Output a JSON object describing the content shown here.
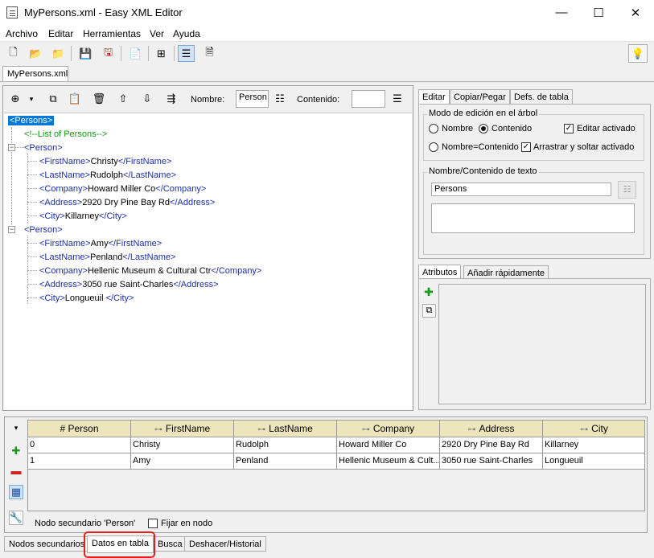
{
  "window": {
    "title": "MyPersons.xml - Easy XML Editor",
    "minimize": "—",
    "maximize": "☐",
    "close": "✕"
  },
  "menu": [
    "Archivo",
    "Editar",
    "Herramientas",
    "Ver",
    "Ayuda"
  ],
  "toolbar_icons": [
    "new-file-icon",
    "open-folder-icon",
    "open-folder-alt-icon",
    "save-icon",
    "save-all-icon",
    "export-icon",
    "tree-structure-icon",
    "text-align-icon",
    "document-icon",
    "lightbulb-icon"
  ],
  "doc_tab": "MyPersons.xml",
  "tree_toolbar": {
    "name_label": "Nombre:",
    "name_value": "Person",
    "content_label": "Contenido:",
    "content_value": ""
  },
  "tree": {
    "root": "<Persons>",
    "comment": "<!--List of Persons-->",
    "person1": {
      "open": "<Person>",
      "firstname": {
        "open": "<FirstName>",
        "value": "Christy",
        "close": "</FirstName>"
      },
      "lastname": {
        "open": "<LastName>",
        "value": "Rudolph",
        "close": "</LastName>"
      },
      "company": {
        "open": "<Company>",
        "value": "Howard Miller Co",
        "close": "</Company>"
      },
      "address": {
        "open": "<Address>",
        "value": "2920 Dry Pine Bay Rd",
        "close": "</Address>"
      },
      "city": {
        "open": "<City>",
        "value": "Killarney",
        "close": "</City>"
      }
    },
    "person2": {
      "open": "<Person>",
      "firstname": {
        "open": "<FirstName>",
        "value": "Amy",
        "close": "</FirstName>"
      },
      "lastname": {
        "open": "<LastName>",
        "value": "Penland",
        "close": "</LastName>"
      },
      "company": {
        "open": "<Company>",
        "value": "Hellenic Museum & Cultural Ctr",
        "close": "</Company>"
      },
      "address": {
        "open": "<Address>",
        "value": "3050 rue Saint-Charles",
        "close": "</Address>"
      },
      "city": {
        "open": "<City>",
        "value": "Longueuil ",
        "close": "</City>"
      }
    }
  },
  "edit_tabs": [
    "Editar",
    "Copiar/Pegar",
    "Defs. de tabla"
  ],
  "edit_panel": {
    "mode_title": "Modo de edición en el árbol",
    "radio_name": "Nombre",
    "radio_content": "Contenido",
    "radio_both": "Nombre=Contenido",
    "edit_enabled": "Editar activado",
    "drag_drop": "Arrastrar y soltar activado",
    "text_title": "Nombre/Contenido de texto",
    "name_field": "Persons",
    "content_field": ""
  },
  "attr_tabs": [
    "Atributos",
    "Añadir rápidamente"
  ],
  "table": {
    "headers": [
      "# Person",
      "FirstName",
      "LastName",
      "Company",
      "Address",
      "City"
    ],
    "rows": [
      [
        "0",
        "Christy",
        "Rudolph",
        "Howard Miller Co",
        "2920 Dry Pine Bay Rd",
        "Killarney"
      ],
      [
        "1",
        "Amy",
        "Penland",
        "Hellenic Museum & Cult...",
        "3050 rue Saint-Charles",
        "Longueuil"
      ]
    ],
    "secondary_node_label": "Nodo secundario 'Person'",
    "pin_label": "Fijar en nodo"
  },
  "bottom_tabs": [
    "Nodos secundarios",
    "Datos en tabla",
    "Busca",
    "Deshacer/Historial"
  ],
  "colors": {
    "tag": "#1d2fa8",
    "comment": "#119911",
    "selection": "#0078d7",
    "header_bg": "#ede6bd",
    "highlight": "#e02020"
  }
}
